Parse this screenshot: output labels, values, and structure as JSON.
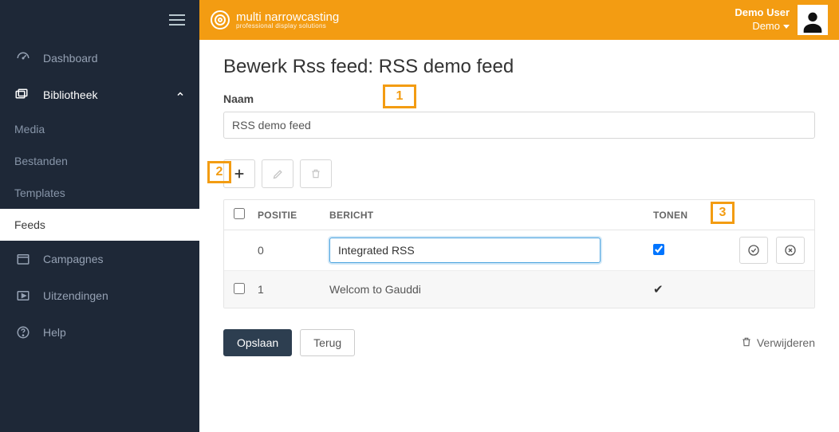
{
  "brand": {
    "line1_a": "multi",
    "line1_b": "narrowcasting",
    "line2": "professional display solutions"
  },
  "user": {
    "name": "Demo User",
    "tenant": "Demo"
  },
  "sidebar": {
    "items": {
      "dashboard": "Dashboard",
      "bibliotheek": "Bibliotheek",
      "campagnes": "Campagnes",
      "uitzendingen": "Uitzendingen",
      "help": "Help"
    },
    "sub": {
      "media": "Media",
      "bestanden": "Bestanden",
      "templates": "Templates",
      "feeds": "Feeds"
    }
  },
  "page": {
    "title": "Bewerk Rss feed: RSS demo feed",
    "name_label": "Naam",
    "name_value": "RSS demo feed"
  },
  "table": {
    "headers": {
      "positie": "POSITIE",
      "bericht": "BERICHT",
      "tonen": "TONEN"
    },
    "rows": [
      {
        "positie": "0",
        "bericht": "Integrated RSS",
        "tonen_checked": true,
        "editing": true
      },
      {
        "positie": "1",
        "bericht": "Welcom to Gauddi",
        "tonen_checked": true,
        "editing": false
      }
    ]
  },
  "footer": {
    "opslaan": "Opslaan",
    "terug": "Terug",
    "verwijderen": "Verwijderen"
  },
  "callouts": {
    "c1": "1",
    "c2": "2",
    "c3": "3"
  }
}
